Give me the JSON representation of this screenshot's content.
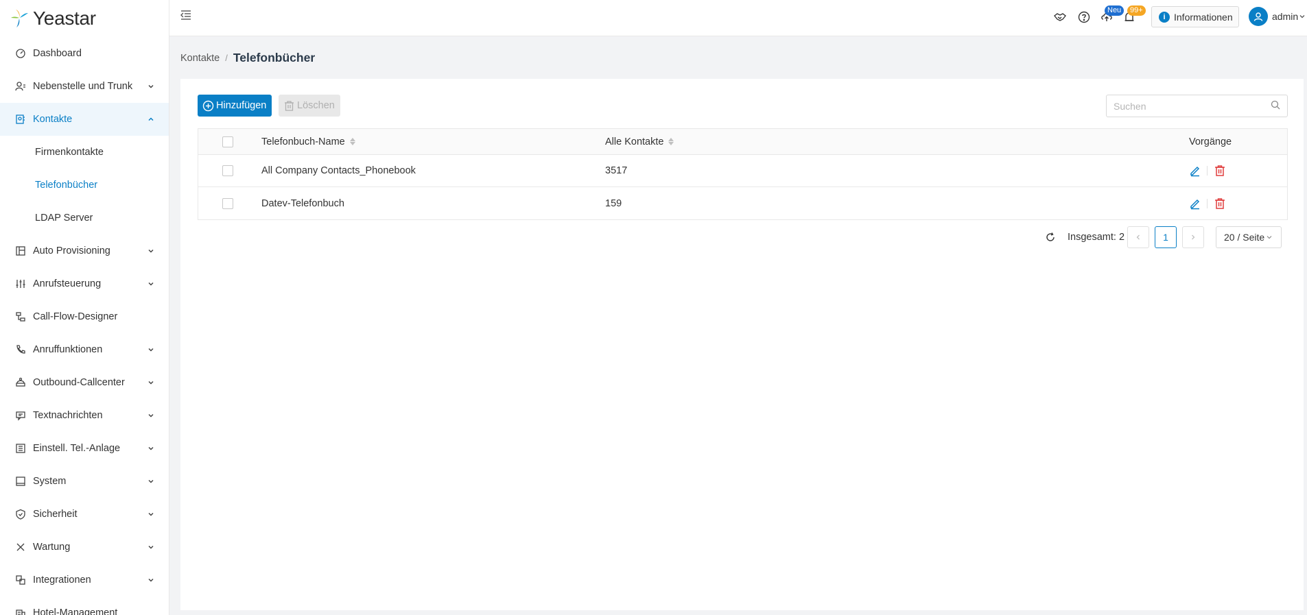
{
  "app": {
    "brand": "Yeastar"
  },
  "sidebar": {
    "items": [
      {
        "label": "Dashboard",
        "icon": "dashboard-icon",
        "chevron": false
      },
      {
        "label": "Nebenstelle und Trunk",
        "icon": "extension-icon",
        "chevron": true
      },
      {
        "label": "Kontakte",
        "icon": "contacts-icon",
        "chevron": true,
        "open": true,
        "children": [
          {
            "label": "Firmenkontakte"
          },
          {
            "label": "Telefonbücher",
            "active": true
          },
          {
            "label": "LDAP Server"
          }
        ]
      },
      {
        "label": "Auto Provisioning",
        "icon": "provisioning-icon",
        "chevron": true
      },
      {
        "label": "Anrufsteuerung",
        "icon": "call-control-icon",
        "chevron": true
      },
      {
        "label": "Call-Flow-Designer",
        "icon": "flow-icon",
        "chevron": false
      },
      {
        "label": "Anruffunktionen",
        "icon": "phone-icon",
        "chevron": true
      },
      {
        "label": "Outbound-Callcenter",
        "icon": "callcenter-icon",
        "chevron": true
      },
      {
        "label": "Textnachrichten",
        "icon": "message-icon",
        "chevron": true
      },
      {
        "label": "Einstell. Tel.-Anlage",
        "icon": "pbx-settings-icon",
        "chevron": true
      },
      {
        "label": "System",
        "icon": "system-icon",
        "chevron": true
      },
      {
        "label": "Sicherheit",
        "icon": "shield-icon",
        "chevron": true
      },
      {
        "label": "Wartung",
        "icon": "wrench-icon",
        "chevron": true
      },
      {
        "label": "Integrationen",
        "icon": "integration-icon",
        "chevron": true
      },
      {
        "label": "Hotel-Management",
        "icon": "hotel-icon",
        "chevron": false
      }
    ]
  },
  "header": {
    "badge_new": "Neu",
    "badge_count": "99+",
    "info_label": "Informationen",
    "username": "admin"
  },
  "breadcrumb": {
    "parent": "Kontakte",
    "current": "Telefonbücher"
  },
  "toolbar": {
    "add_label": "Hinzufügen",
    "delete_label": "Löschen",
    "search_placeholder": "Suchen"
  },
  "table": {
    "columns": {
      "name": "Telefonbuch-Name",
      "count": "Alle Kontakte",
      "ops": "Vorgänge"
    },
    "rows": [
      {
        "name": "All Company Contacts_Phonebook",
        "count": "3517"
      },
      {
        "name": "Datev-Telefonbuch",
        "count": "159"
      }
    ]
  },
  "pagination": {
    "total_label": "Insgesamt: 2",
    "current_page": "1",
    "page_size": "20 / Seite"
  },
  "colors": {
    "accent": "#0a7fc6",
    "danger": "#e03e3e",
    "badge_new": "#1f6fd1",
    "badge_count": "#f5a623"
  }
}
